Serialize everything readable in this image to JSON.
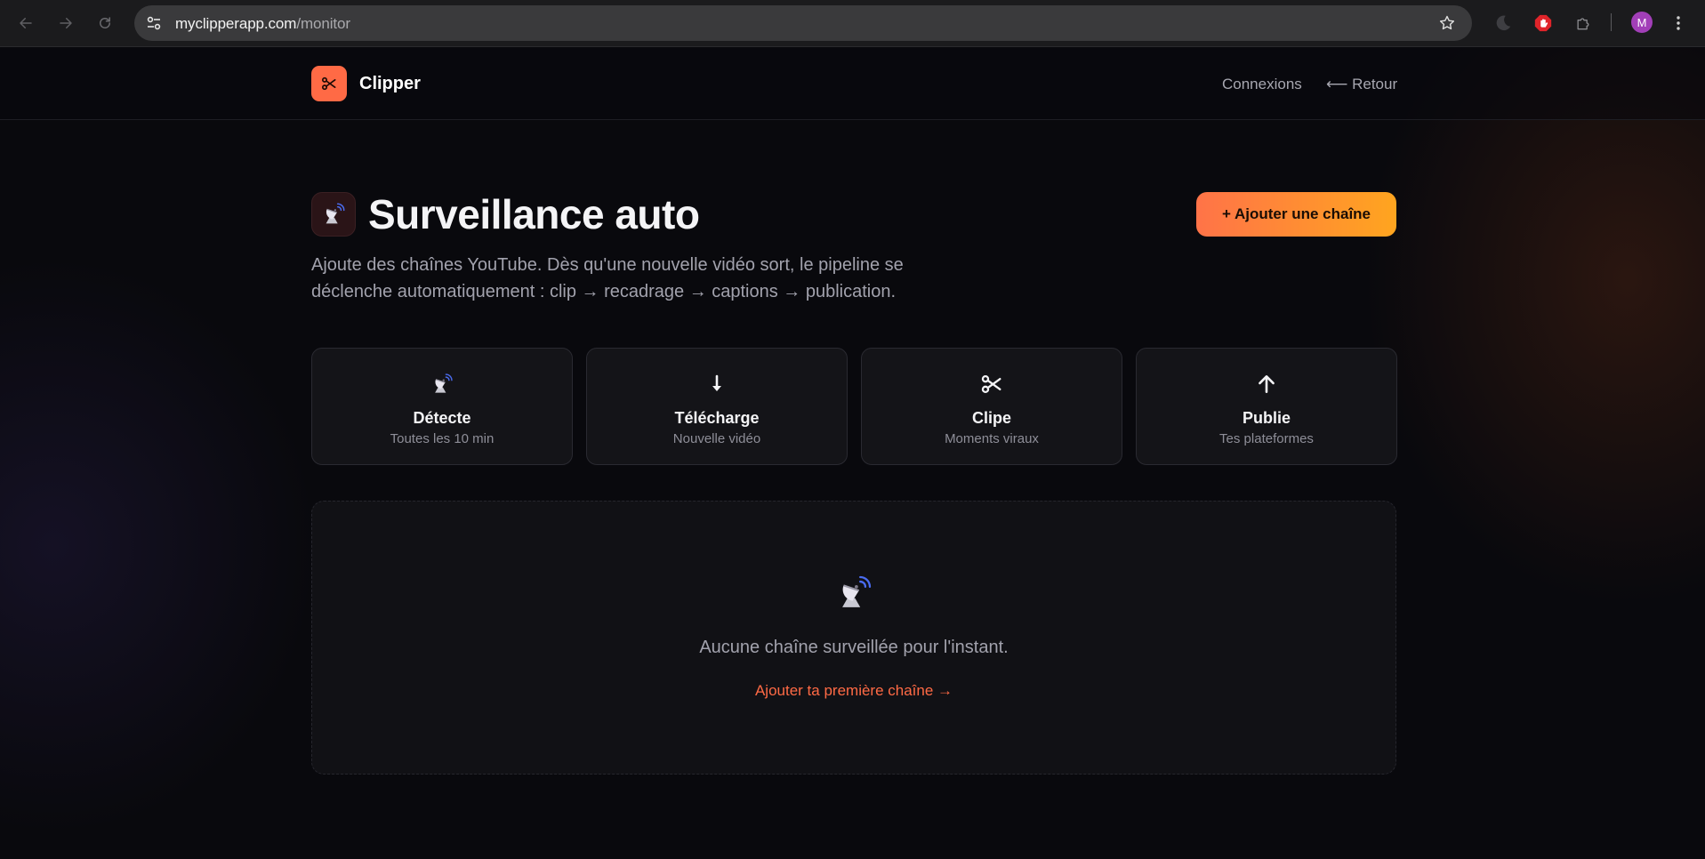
{
  "browser": {
    "url_host": "myclipperapp.com",
    "url_path": "/monitor",
    "avatar_letter": "M"
  },
  "header": {
    "brand": "Clipper",
    "nav_connexions": "Connexions",
    "nav_retour": "⟵ Retour"
  },
  "main": {
    "title": "Surveillance auto",
    "add_button": "+ Ajouter une chaîne",
    "subtitle": "Ajoute des chaînes YouTube. Dès qu'une nouvelle vidéo sort, le pipeline se déclenche automatiquement : clip → recadrage → captions → publication."
  },
  "steps": [
    {
      "icon": "satellite-dish-icon",
      "title": "Détecte",
      "subtitle": "Toutes les 10 min"
    },
    {
      "icon": "download-arrow-icon",
      "title": "Télécharge",
      "subtitle": "Nouvelle vidéo"
    },
    {
      "icon": "scissors-icon",
      "title": "Clipe",
      "subtitle": "Moments viraux"
    },
    {
      "icon": "upload-arrow-icon",
      "title": "Publie",
      "subtitle": "Tes plateformes"
    }
  ],
  "empty_state": {
    "icon": "satellite-dish-icon",
    "message": "Aucune chaîne surveillée pour l'instant.",
    "cta": "Ajouter ta première chaîne →"
  },
  "colors": {
    "accent": "#ff6a45",
    "button_gradient_start": "#ff7348",
    "button_gradient_end": "#ffa51f",
    "background": "#09090d"
  }
}
